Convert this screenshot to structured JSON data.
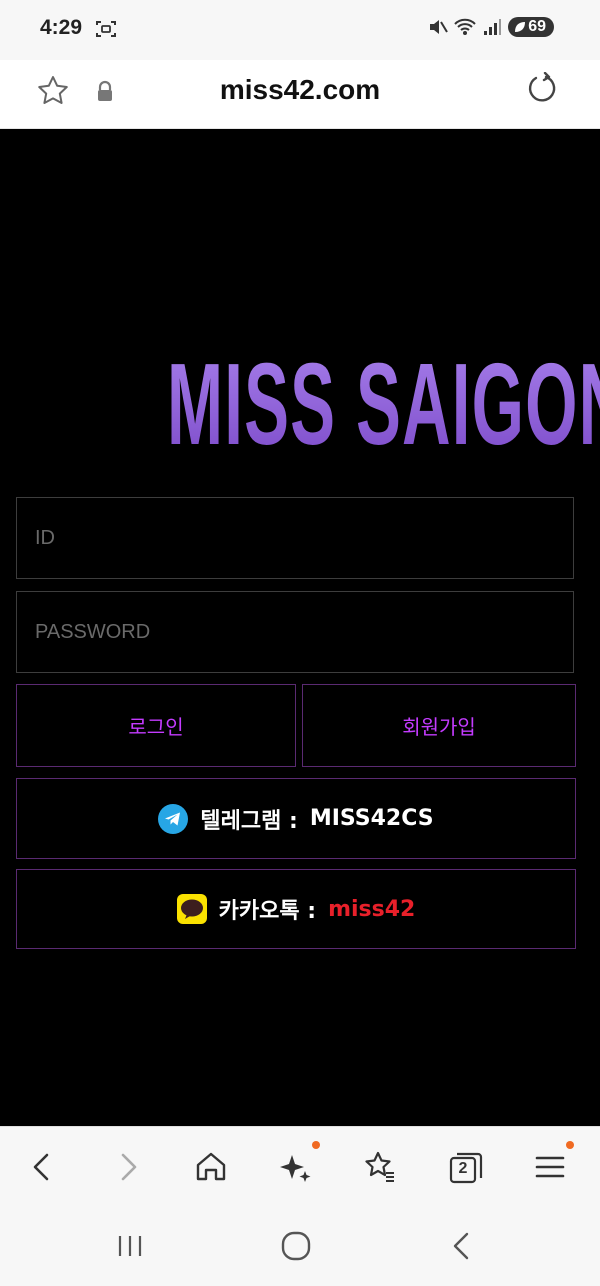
{
  "status_bar": {
    "time": "4:29",
    "battery": "69"
  },
  "browser": {
    "url": "miss42.com"
  },
  "page": {
    "logo": "MISS SAIGON",
    "id_placeholder": "ID",
    "password_placeholder": "PASSWORD",
    "login_label": "로그인",
    "signup_label": "회원가입",
    "telegram": {
      "label": "텔레그램 :",
      "value": "MISS42CS"
    },
    "kakao": {
      "label": "카카오톡 :",
      "value": "miss42"
    }
  },
  "toolbar": {
    "tabs_count": "2"
  },
  "colors": {
    "accent_purple": "#c43bff",
    "logo_purple": "#8a5cd6",
    "kakao_red": "#e8202a",
    "border_purple": "#5a2a72",
    "badge_orange": "#f06a22"
  }
}
